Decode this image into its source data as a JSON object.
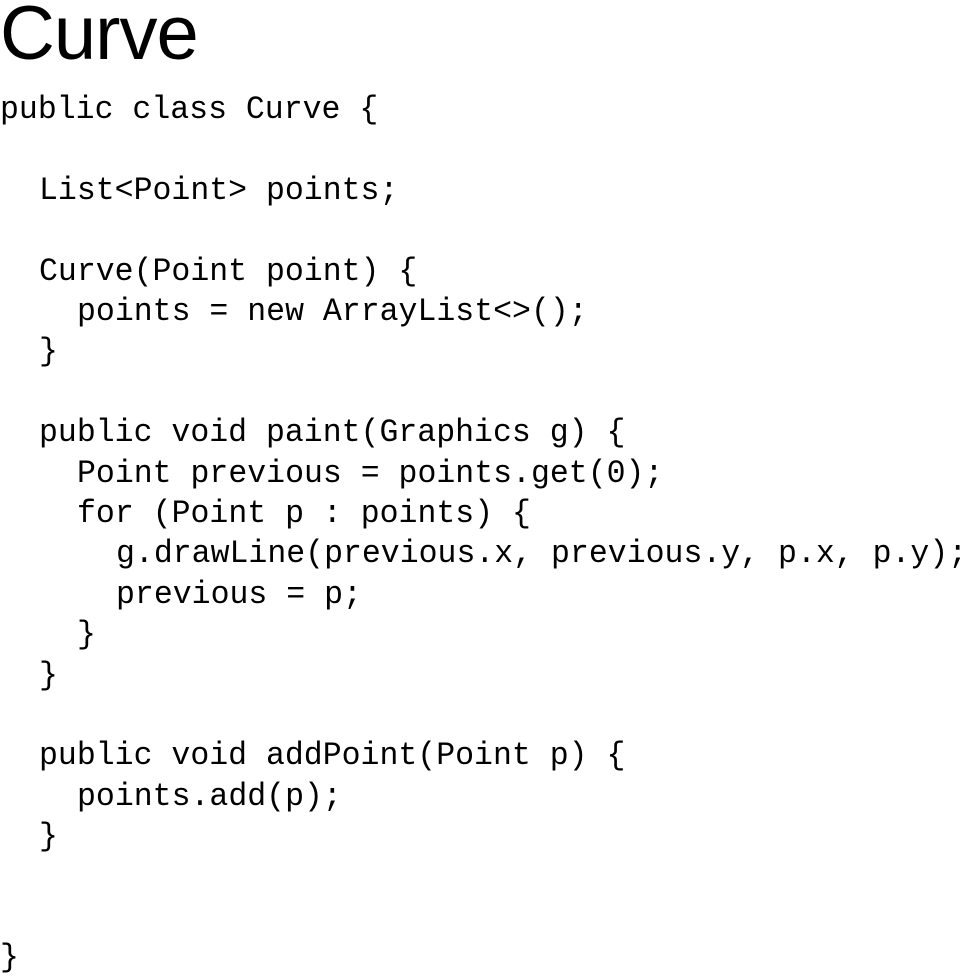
{
  "title": "Curve",
  "code": {
    "language": "java",
    "lines": [
      {
        "indent": 0,
        "text": "public class Curve {"
      },
      {
        "indent": 0,
        "text": ""
      },
      {
        "indent": 1,
        "text": "List<Point> points;"
      },
      {
        "indent": 0,
        "text": ""
      },
      {
        "indent": 1,
        "text": "Curve(Point point) {"
      },
      {
        "indent": 2,
        "text": "points = new ArrayList<>();"
      },
      {
        "indent": 1,
        "text": "}"
      },
      {
        "indent": 0,
        "text": ""
      },
      {
        "indent": 1,
        "text": "public void paint(Graphics g) {"
      },
      {
        "indent": 2,
        "text": "Point previous = points.get(0);"
      },
      {
        "indent": 2,
        "text": "for (Point p : points) {"
      },
      {
        "indent": 3,
        "text": "g.drawLine(previous.x, previous.y, p.x, p.y);"
      },
      {
        "indent": 3,
        "text": "previous = p;"
      },
      {
        "indent": 2,
        "text": "}"
      },
      {
        "indent": 1,
        "text": "}"
      },
      {
        "indent": 0,
        "text": ""
      },
      {
        "indent": 1,
        "text": "public void addPoint(Point p) {"
      },
      {
        "indent": 2,
        "text": "points.add(p);"
      },
      {
        "indent": 1,
        "text": "}"
      },
      {
        "indent": 0,
        "text": ""
      },
      {
        "indent": 0,
        "text": ""
      },
      {
        "indent": 0,
        "text": "}"
      }
    ]
  }
}
